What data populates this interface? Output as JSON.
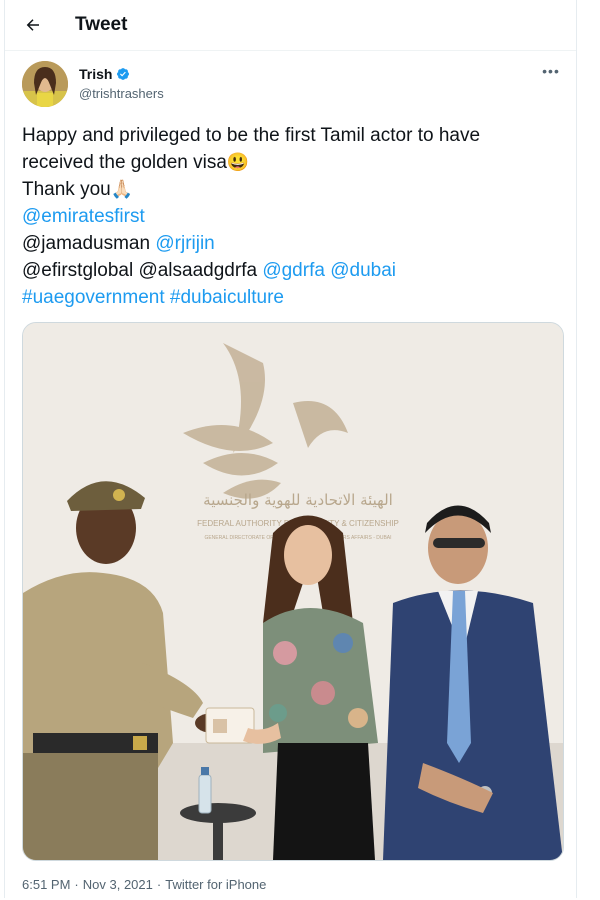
{
  "header": {
    "title": "Tweet",
    "back_icon": "arrow-left-icon"
  },
  "author": {
    "name": "Trish",
    "handle": "@trishtrashers",
    "verified": true,
    "verified_color": "#1d9bf0"
  },
  "tweet": {
    "line1": "Happy and privileged to be the first Tamil actor to have",
    "line2_text": "received the golden visa",
    "line2_emoji": "😃",
    "line3_text": "Thank you",
    "line3_emoji": "🙏🏻",
    "mention_emiratesfirst": "@emiratesfirst",
    "mention_jamadusman": "@jamadusman",
    "mention_rjrijin": "@rjrijin",
    "mention_efirstglobal": "@efirstglobal",
    "mention_alsaadgdrfa": "@alsaadgdrfa",
    "mention_gdrfa": "@gdrfa",
    "mention_dubai": "@dubai",
    "hashtag_uaegovernment": "#uaegovernment",
    "hashtag_dubaiculture": "#dubaiculture"
  },
  "media": {
    "sign_arabic": "الهيئة الاتحادية للهوية والجنسية",
    "sign_english": "FEDERAL AUTHORITY FOR IDENTITY & CITIZENSHIP",
    "sign_sub": "GENERAL DIRECTORATE OF RESIDENCY AND FOREIGNERS AFFAIRS - DUBAI"
  },
  "meta": {
    "time": "6:51 PM",
    "date": "Nov 3, 2021",
    "source": "Twitter for iPhone"
  },
  "colors": {
    "link": "#1d9bf0",
    "muted": "#536471",
    "text": "#0f1419"
  }
}
